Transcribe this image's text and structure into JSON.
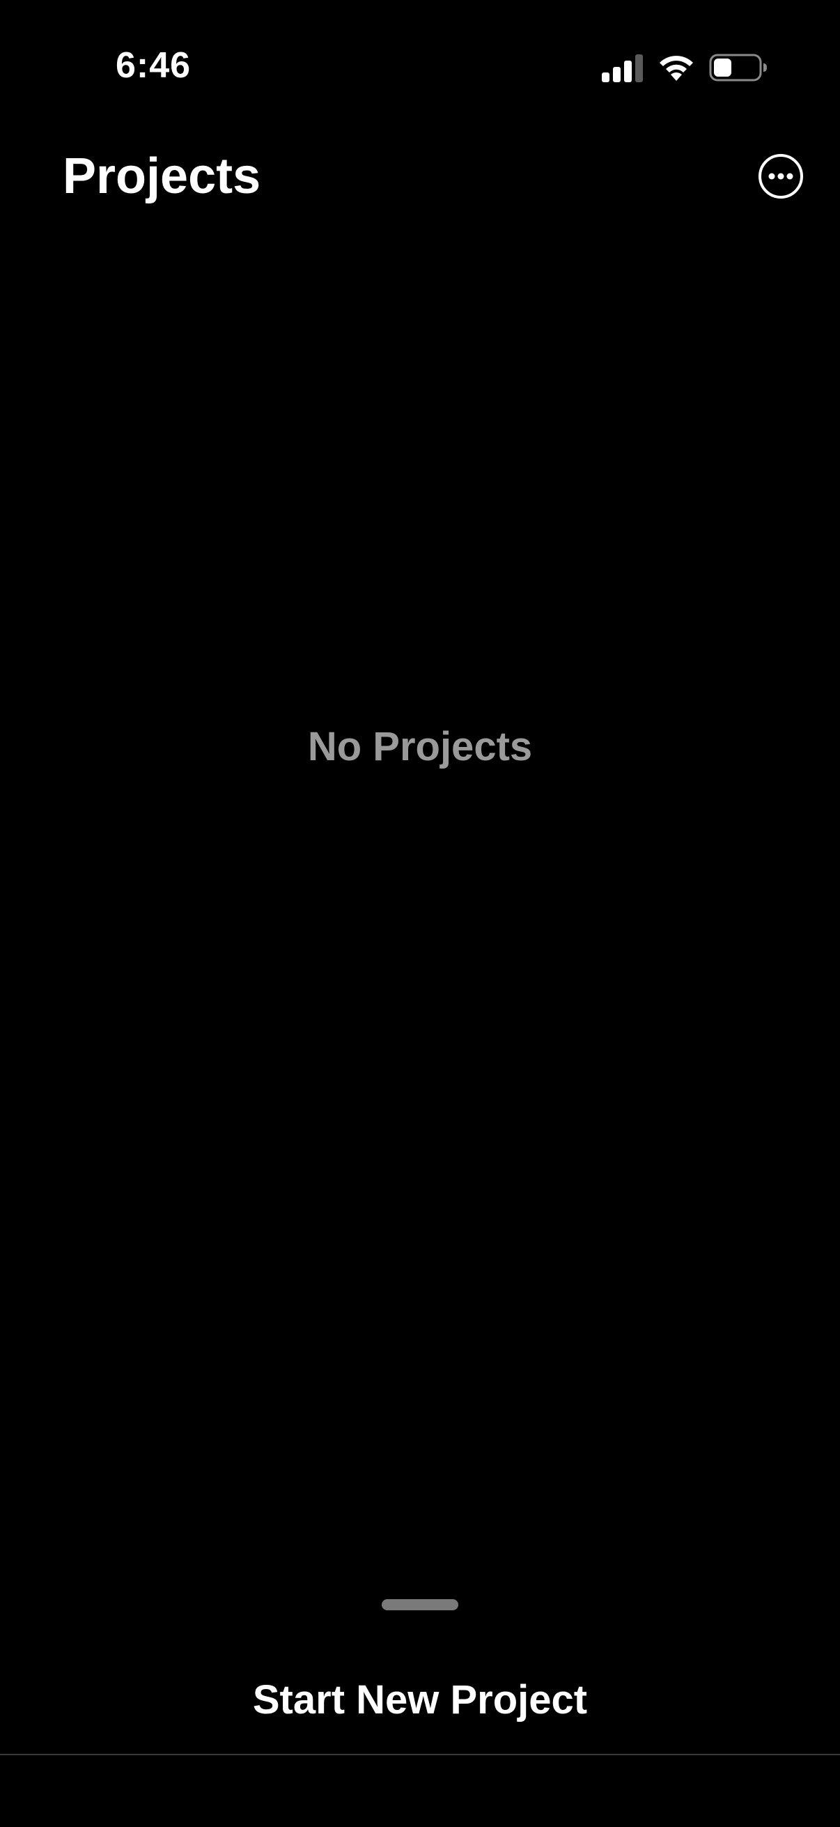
{
  "status_bar": {
    "time": "6:46",
    "signal_icon": "cellular-signal-icon",
    "wifi_icon": "wifi-icon",
    "battery_icon": "battery-icon",
    "battery_level": 0.4
  },
  "header": {
    "title": "Projects",
    "more_icon": "ellipsis-circle-icon"
  },
  "main": {
    "empty_message": "No Projects"
  },
  "bottom_sheet": {
    "action_label": "Start New Project"
  },
  "colors": {
    "background": "#000000",
    "text_primary": "#ffffff",
    "text_secondary": "#9a9a9a",
    "grabber": "#7a7a7a"
  }
}
